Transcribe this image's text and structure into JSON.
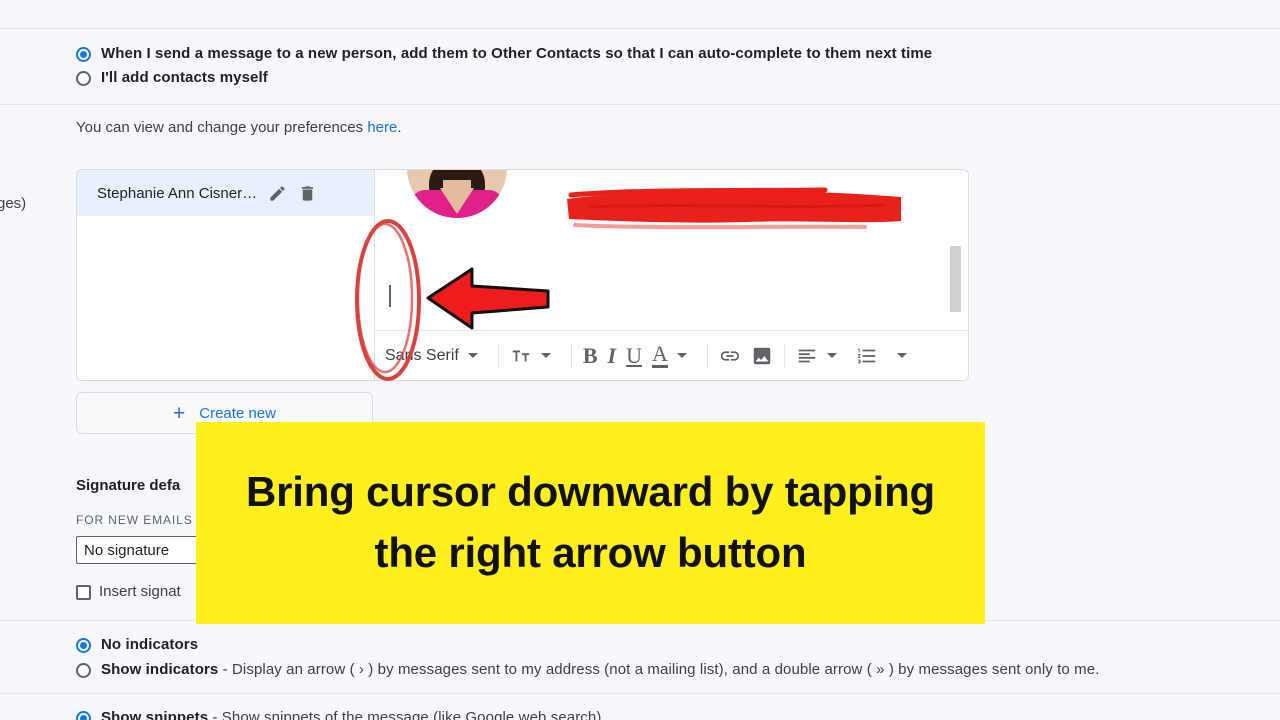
{
  "page": {
    "background_color": "#f6f8fc",
    "left_cut_text": "ges)"
  },
  "contacts_options": {
    "auto_add_label": "When I send a message to a new person, add them to Other Contacts so that I can auto-complete to them next time",
    "auto_add_selected": true,
    "manual_add_label": "I'll add contacts myself",
    "manual_add_selected": false,
    "preferences_text_before": "You can view and change your preferences ",
    "preferences_link": "here",
    "preferences_text_after": "."
  },
  "signature": {
    "list": [
      {
        "name": "Stephanie Ann Cisner…",
        "selected": true,
        "edit_icon": "pencil-icon",
        "delete_icon": "trash-icon"
      }
    ],
    "editor": {
      "caret_visible": true,
      "redaction_color": "#e8211b",
      "scrollbar_color": "#cfd2d5"
    },
    "toolbar": {
      "font_family_label": "Sans Serif",
      "items": [
        {
          "name": "font-family-dropdown",
          "label": "Sans Serif",
          "icon": "chevron-down-icon"
        },
        {
          "name": "font-size-button",
          "label": "",
          "icon": "font-size-icon"
        },
        {
          "name": "bold-button",
          "label": "B",
          "icon": "bold-icon"
        },
        {
          "name": "italic-button",
          "label": "I",
          "icon": "italic-icon"
        },
        {
          "name": "underline-button",
          "label": "U",
          "icon": "underline-icon"
        },
        {
          "name": "text-color-button",
          "label": "A",
          "icon": "text-color-icon"
        },
        {
          "name": "insert-link-button",
          "label": "",
          "icon": "link-icon"
        },
        {
          "name": "insert-image-button",
          "label": "",
          "icon": "image-icon"
        },
        {
          "name": "align-button",
          "label": "",
          "icon": "align-left-icon"
        },
        {
          "name": "numbered-list-button",
          "label": "",
          "icon": "numbered-list-icon"
        },
        {
          "name": "more-options-button",
          "label": "",
          "icon": "chevron-down-icon"
        }
      ]
    },
    "create_new_label": "Create new",
    "create_new_plus": "+"
  },
  "signature_defaults": {
    "title": "Signature defa",
    "for_new_emails_label": "FOR NEW EMAILS",
    "selected_signature": "No signature",
    "insert_signature_label": "Insert signat",
    "insert_signature_checked": false
  },
  "personal_indicators": {
    "no_indicators_label": "No indicators",
    "no_indicators_selected": true,
    "show_indicators_bold": "Show indicators",
    "show_indicators_rest": " - Display an arrow ( › ) by messages sent to my address (not a mailing list), and a double arrow ( » ) by messages sent only to me.",
    "show_indicators_selected": false
  },
  "snippets": {
    "show_snippets_bold": "Show snippets",
    "show_snippets_rest": " - Show snippets of the message (like Google web search).",
    "show_snippets_selected": true
  },
  "annotations": {
    "callout_text": "Bring cursor downward by tapping the right arrow button",
    "callout_background": "#ffef1f",
    "callout_text_color": "#111111",
    "arrow_color": "#ee1c1c",
    "ellipse_color": "#d9433f",
    "redaction_color": "#e8211b"
  }
}
